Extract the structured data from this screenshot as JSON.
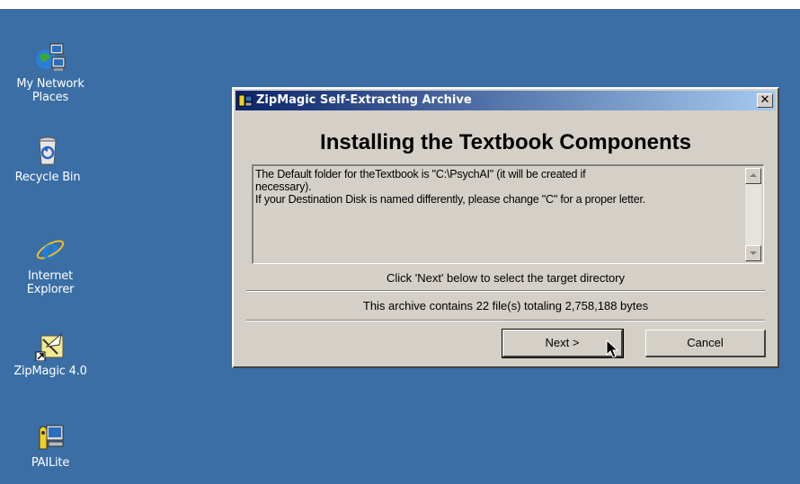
{
  "desktop": {
    "icons": [
      {
        "label": "My Network Places",
        "icon": "network-places-icon"
      },
      {
        "label": "Recycle Bin",
        "icon": "recycle-bin-icon"
      },
      {
        "label": "Internet Explorer",
        "icon": "internet-explorer-icon"
      },
      {
        "label": "ZipMagic 4.0",
        "icon": "zipmagic-icon"
      },
      {
        "label": "PAILite",
        "icon": "pailite-icon"
      }
    ],
    "background_color": "#3a6ea5"
  },
  "dialog": {
    "title": "ZipMagic Self-Extracting Archive",
    "close_label": "✕",
    "heading": "Installing the Textbook Components",
    "message_lines": [
      "The Default folder for theTextbook is \"C:\\PsychAI\" (it will be created if",
      "necessary).",
      "If your Destination Disk is named differently, please change \"C\" for a proper letter."
    ],
    "hint": "Click 'Next' below to select the target directory",
    "info": "This archive contains 22 file(s) totaling 2,758,188 bytes",
    "next_label": "Next >",
    "cancel_label": "Cancel",
    "titlebar_colors": [
      "#0a246a",
      "#a6caf0"
    ]
  }
}
